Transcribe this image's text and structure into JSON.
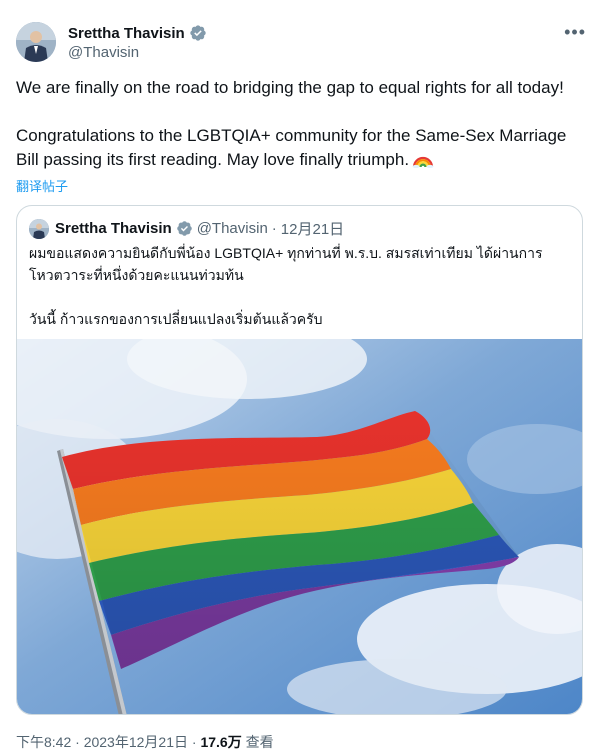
{
  "author": {
    "display_name": "Srettha Thavisin",
    "handle": "@Thavisin",
    "verified": true
  },
  "icons": {
    "verified": "verified-badge-icon",
    "more": "more-options-icon",
    "emoji": "rainbow-emoji"
  },
  "colors": {
    "link_blue": "#1d9bf0",
    "secondary_text": "#536471",
    "verified_badge": "#829aab"
  },
  "tweet": {
    "line1": "We are finally on the road to bridging the gap to equal rights for all today!",
    "line2": "Congratulations to the LGBTQIA+ community for the Same-Sex Marriage Bill passing its first reading. May love finally triumph.",
    "translate_label": "翻译帖子"
  },
  "quote": {
    "display_name": "Srettha Thavisin",
    "handle": "@Thavisin",
    "separator": "·",
    "date": "12月21日",
    "text_line1": "ผมขอแสดงความยินดีกับพี่น้อง LGBTQIA+ ทุกท่านที่ พ.ร.บ. สมรสเท่าเทียม ได้ผ่านการโหวตวาระที่หนึ่งด้วยคะแนนท่วมท้น",
    "text_line2": "วันนี้ ก้าวแรกของการเปลี่ยนแปลงเริ่มต้นแล้วครับ"
  },
  "meta": {
    "time": "下午8:42",
    "separator": "·",
    "date": "2023年12月21日",
    "views_count": "17.6万",
    "views_label": "查看"
  }
}
